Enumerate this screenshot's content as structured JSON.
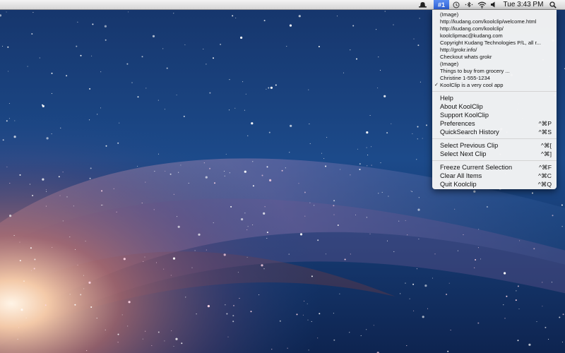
{
  "menubar": {
    "app_badge": "#1",
    "clock": "Tue 3:43 PM",
    "icons": [
      "hat-icon",
      "app-badge",
      "time-machine-icon",
      "bluetooth-icon",
      "wifi-icon",
      "volume-icon",
      "spotlight-icon"
    ]
  },
  "menu": {
    "clips": [
      {
        "label": "(Image)",
        "checked": false
      },
      {
        "label": "http://kudang.com/koolclip/welcome.html",
        "checked": false
      },
      {
        "label": "http://kudang.com/koolclip/",
        "checked": false
      },
      {
        "label": "koolclipmac@kudang.com",
        "checked": false
      },
      {
        "label": "Copyright Kudang Technologies P/L, all r...",
        "checked": false
      },
      {
        "label": "http://grokr.info/",
        "checked": false
      },
      {
        "label": "Checkout whats grokr",
        "checked": false
      },
      {
        "label": "(Image)",
        "checked": false
      },
      {
        "label": "Things to buy from grocery ...",
        "checked": false
      },
      {
        "label": "Christine 1-555-1234",
        "checked": false
      },
      {
        "label": "KoolClip is a very cool app",
        "checked": true,
        "checkmark": "✓"
      }
    ],
    "help": {
      "help": "Help",
      "about": "About KoolClip",
      "support": "Support KoolClip",
      "preferences": "Preferences",
      "preferences_shortcut": "^⌘P",
      "quicksearch": "QuickSearch History",
      "quicksearch_shortcut": "^⌘S"
    },
    "navigation": {
      "previous": "Select Previous Clip",
      "previous_shortcut": "^⌘[",
      "next": "Select Next Clip",
      "next_shortcut": "^⌘]"
    },
    "actions": {
      "freeze": "Freeze Current Selection",
      "freeze_shortcut": "^⌘F",
      "clear": "Clear All Items",
      "clear_shortcut": "^⌘C",
      "quit": "Quit Koolclip",
      "quit_shortcut": "^⌘Q"
    }
  },
  "colors": {
    "badge": "#3a6fe0",
    "menu_bg": "#f5f5f5",
    "space_dark": "#0c1c3c"
  }
}
